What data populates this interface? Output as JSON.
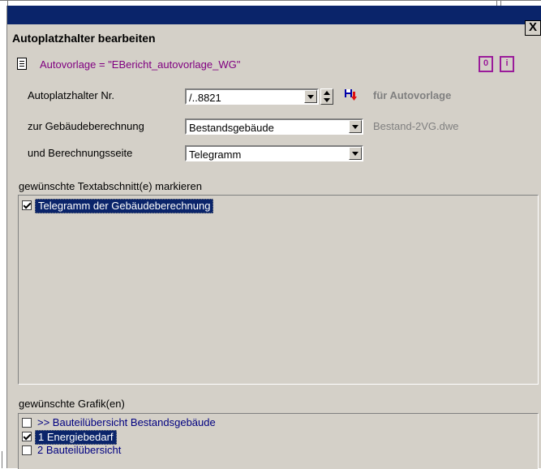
{
  "dialog": {
    "title": "Autoplatzhalter bearbeiten",
    "close_glyph": "X",
    "subtitle": "Autovorlage = \"EBericht_autovorlage_WG\"",
    "icon_left_glyph": "0",
    "icon_right_glyph": "i"
  },
  "form": {
    "nr_label": "Autoplatzhalter Nr.",
    "nr_value": "/..8821",
    "fuer_label": "für Autovorlage",
    "calc_label": "zur Gebäudeberechnung",
    "calc_value": "Bestandsgebäude",
    "calc_file": "Bestand-2VG.dwe",
    "page_label": "und Berechnungsseite",
    "page_value": "Telegramm"
  },
  "text_sections": {
    "label": "gewünschte Textabschnitt(e) markieren",
    "items": [
      {
        "text": "Telegramm der Gebäudeberechnung",
        "checked": true,
        "selected": true
      }
    ]
  },
  "graphics": {
    "label": "gewünschte Grafik(en)",
    "items": [
      {
        "text": ">> Bauteilübersicht Bestandsgebäude",
        "checked": false,
        "selected": false
      },
      {
        "text": "1 Energiebedarf",
        "checked": true,
        "selected": true
      },
      {
        "text": "2 Bauteilübersicht",
        "checked": false,
        "selected": false
      }
    ]
  },
  "colors": {
    "titlebar": "#0a246a",
    "dialog_bg": "#d4d0c8",
    "subtitle_purple": "#800080",
    "selection": "#0a246a"
  }
}
